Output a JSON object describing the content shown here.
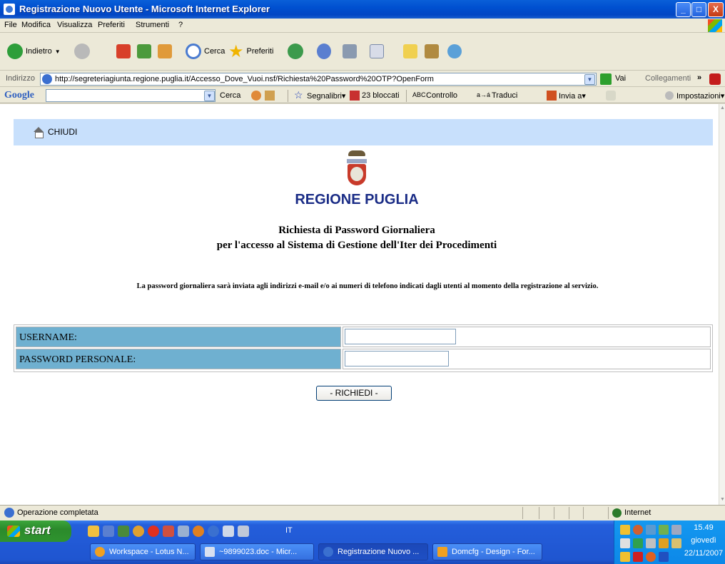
{
  "window": {
    "title": "Registrazione Nuovo Utente - Microsoft Internet Explorer",
    "min": "_",
    "max": "□",
    "close": "X"
  },
  "menu": [
    "File",
    "Modifica",
    "Visualizza",
    "Preferiti",
    "Strumenti",
    "?"
  ],
  "toolbar": {
    "back": "Indietro",
    "search": "Cerca",
    "favorites": "Preferiti"
  },
  "address": {
    "label": "Indirizzo",
    "url": "http://segreteriagiunta.regione.puglia.it/Accesso_Dove_Vuoi.nsf/Richiesta%20Password%20OTP?OpenForm",
    "go": "Vai",
    "links": "Collegamenti",
    "more": "»"
  },
  "googlebar": {
    "logo": "Google",
    "search": "Cerca",
    "bookmarks": "Segnalibri▾",
    "blocked": "23 bloccati",
    "check": "Controllo",
    "translate": "Traduci",
    "send": "Invia a▾",
    "settings": "Impostazioni▾"
  },
  "page": {
    "close": "CHIUDI",
    "region": "REGIONE PUGLIA",
    "subtitle1": "Richiesta di Password Giornaliera",
    "subtitle2": "per l'accesso al Sistema di Gestione dell'Iter dei Procedimenti",
    "notice": "La password giornaliera sarà inviata agli indirizzi e-mail e/o ai numeri di telefono indicati dagli utenti al momento della registrazione al servizio.",
    "username_label": "USERNAME:",
    "username_value": "",
    "password_label": "PASSWORD PERSONALE:",
    "password_value": "",
    "submit": "- RICHIEDI -"
  },
  "status": {
    "text": "Operazione completata",
    "zone": "Internet"
  },
  "taskbar": {
    "start": "start",
    "lang": "IT",
    "tasks": [
      "Workspace - Lotus N...",
      "~9899023.doc - Micr...",
      "Registrazione Nuovo ...",
      "Domcfg - Design - For..."
    ],
    "time": "15.49",
    "day": "giovedì",
    "date": "22/11/2007"
  },
  "colors": {
    "region_blue": "#1a2c86",
    "label_cell": "#6fb0d0",
    "close_bar": "#c8e0fc"
  }
}
